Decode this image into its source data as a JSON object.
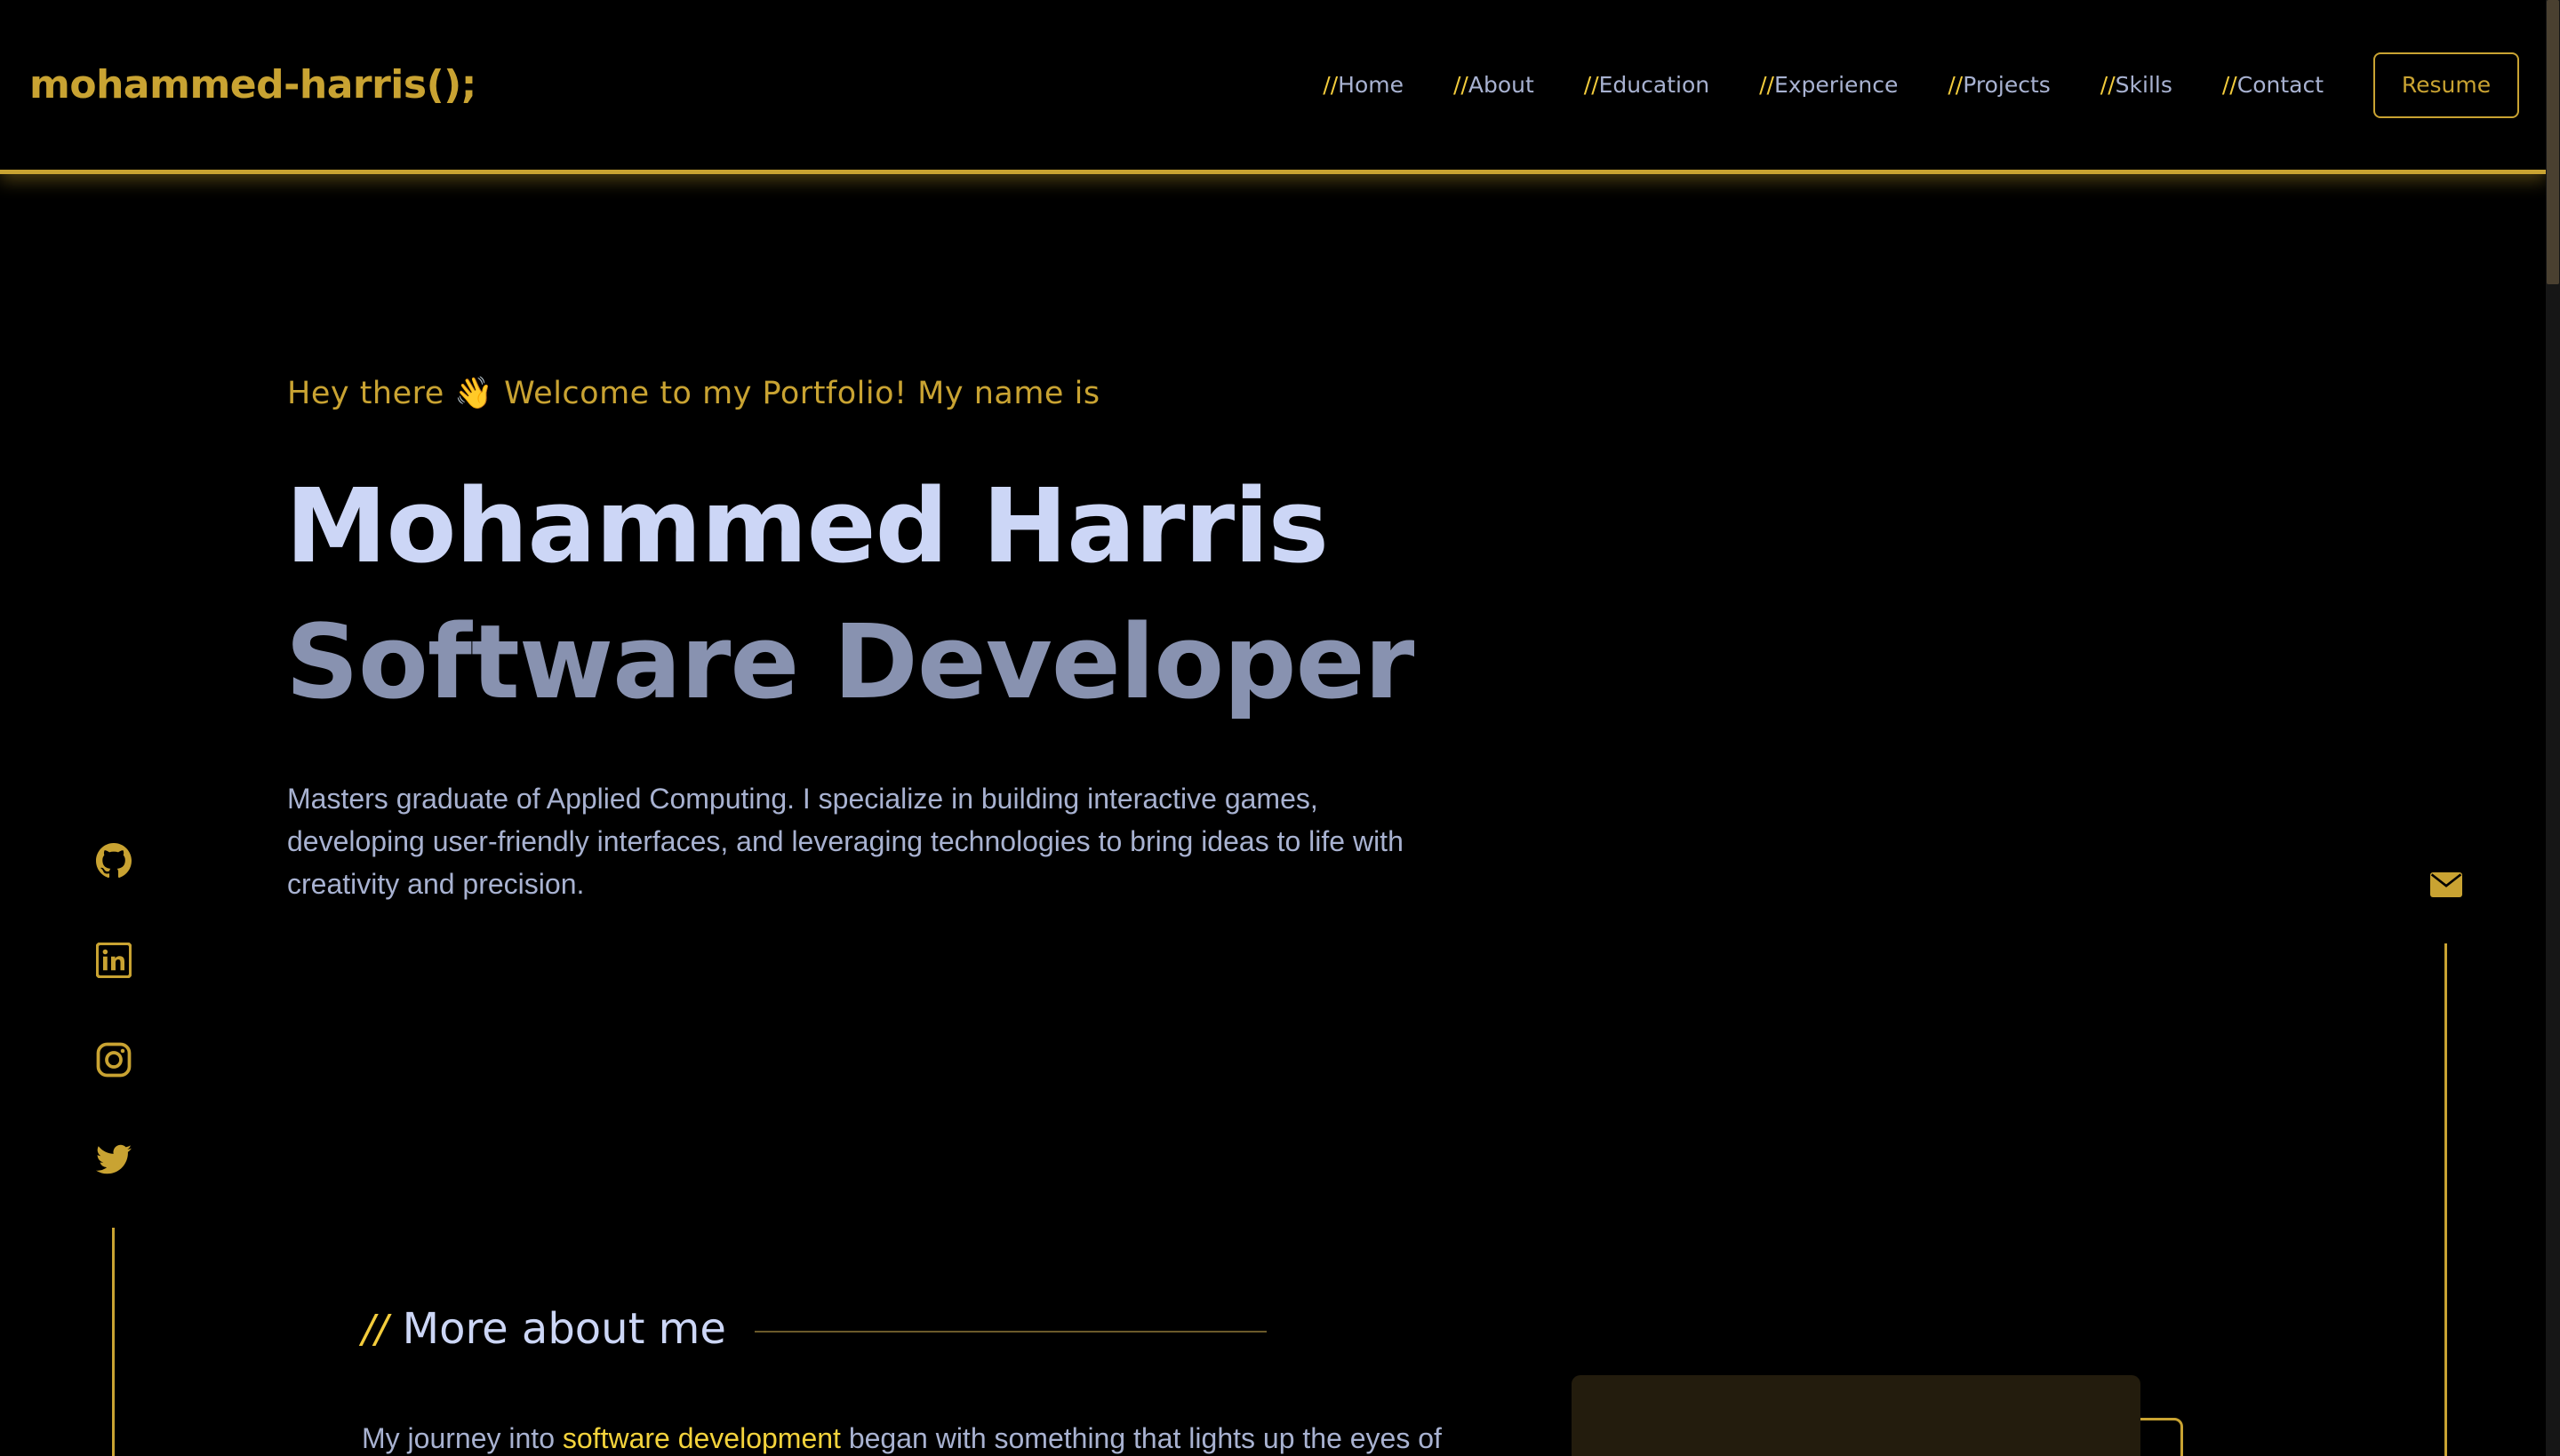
{
  "header": {
    "logo": "mohammed-harris();",
    "nav": [
      {
        "prefix": "//",
        "label": "Home"
      },
      {
        "prefix": "//",
        "label": "About"
      },
      {
        "prefix": "//",
        "label": "Education"
      },
      {
        "prefix": "//",
        "label": "Experience"
      },
      {
        "prefix": "//",
        "label": "Projects"
      },
      {
        "prefix": "//",
        "label": "Skills"
      },
      {
        "prefix": "//",
        "label": "Contact"
      }
    ],
    "resume_label": "Resume"
  },
  "hero": {
    "greeting": "Hey there 👋 Welcome to my Portfolio! My name is",
    "name": "Mohammed Harris",
    "role": "Software Developer",
    "description": "Masters graduate of Applied Computing. I specialize in building interactive games, developing user-friendly interfaces, and leveraging technologies to bring ideas to life with creativity and precision."
  },
  "social": {
    "icons": [
      "github-icon",
      "linkedin-icon",
      "instagram-icon",
      "twitter-icon"
    ]
  },
  "email": {
    "icon": "envelope-icon"
  },
  "about": {
    "prefix": "//",
    "title": "More about me",
    "text_before": "My journey into ",
    "text_highlight": "software development",
    "text_after": " began with something that lights up the eyes of"
  },
  "colors": {
    "accent": "#c9a332",
    "highlight": "#f3d33c",
    "background": "#000000",
    "heading": "#ccd6f6",
    "muted": "#8892b0"
  }
}
